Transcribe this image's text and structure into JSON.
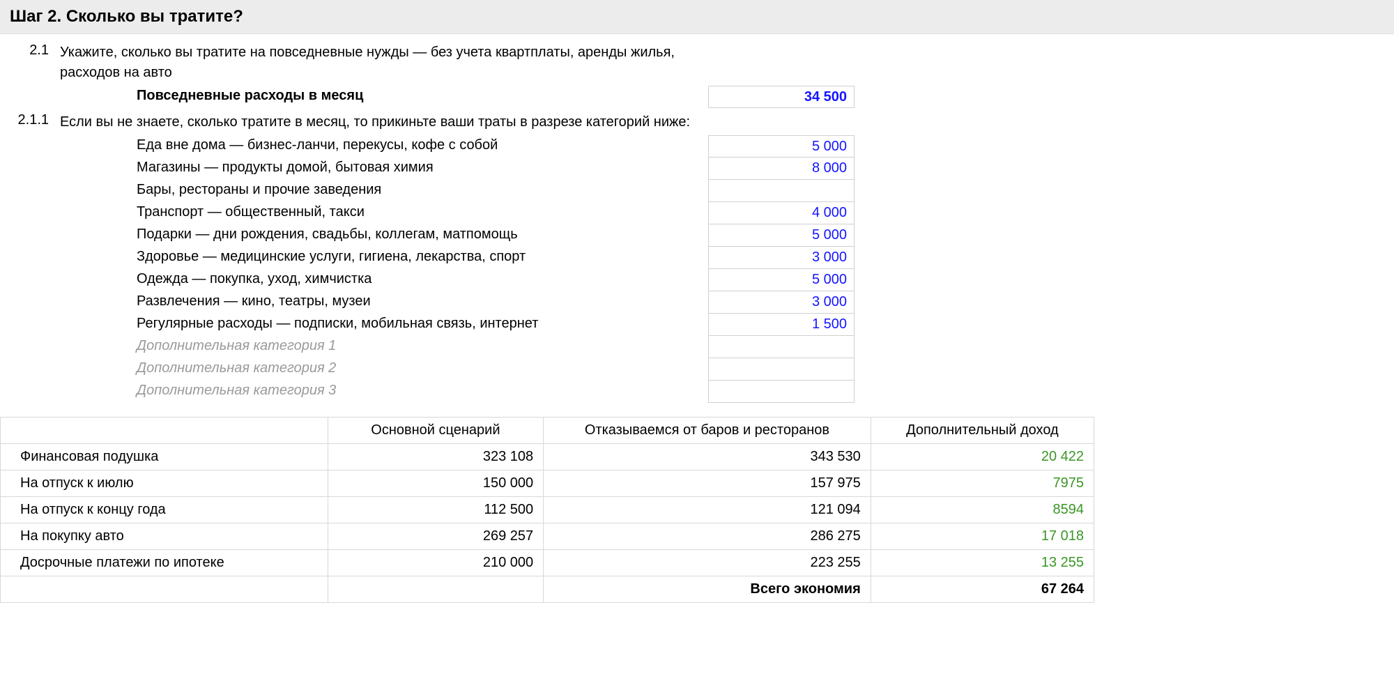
{
  "step": {
    "title": "Шаг 2. Сколько вы тратите?",
    "item21_num": "2.1",
    "item21_text": "Укажите, сколько вы тратите на повседневные нужды — без учета квартплаты, аренды жилья, расходов на авто",
    "monthly_label": "Повседневные расходы в месяц",
    "monthly_value": "34 500",
    "item211_num": "2.1.1",
    "item211_text": "Если вы не знаете, сколько тратите в месяц, то прикиньте ваши траты в разрезе категорий ниже:"
  },
  "categories": [
    {
      "label": "Еда вне дома — бизнес-ланчи, перекусы, кофе с собой",
      "value": "5 000",
      "placeholder": false
    },
    {
      "label": "Магазины — продукты домой, бытовая химия",
      "value": "8 000",
      "placeholder": false
    },
    {
      "label": "Бары, рестораны и прочие заведения",
      "value": "",
      "placeholder": false
    },
    {
      "label": "Транспорт — общественный, такси",
      "value": "4 000",
      "placeholder": false
    },
    {
      "label": "Подарки — дни рождения, свадьбы, коллегам, матпомощь",
      "value": "5 000",
      "placeholder": false
    },
    {
      "label": "Здоровье — медицинские услуги, гигиена, лекарства, спорт",
      "value": "3 000",
      "placeholder": false
    },
    {
      "label": "Одежда — покупка, уход, химчистка",
      "value": "5 000",
      "placeholder": false
    },
    {
      "label": "Развлечения — кино, театры, музеи",
      "value": "3 000",
      "placeholder": false
    },
    {
      "label": "Регулярные расходы — подписки, мобильная связь, интернет",
      "value": "1 500",
      "placeholder": false
    },
    {
      "label": "Дополнительная категория 1",
      "value": "",
      "placeholder": true
    },
    {
      "label": "Дополнительная категория 2",
      "value": "",
      "placeholder": true
    },
    {
      "label": "Дополнительная категория 3",
      "value": "",
      "placeholder": true
    }
  ],
  "summary": {
    "headers": [
      "",
      "Основной сценарий",
      "Отказываемся от баров и ресторанов",
      "Дополнительный доход"
    ],
    "rows": [
      {
        "label": "Финансовая подушка",
        "c1": "323 108",
        "c2": "343 530",
        "c3": "20 422"
      },
      {
        "label": "На отпуск к июлю",
        "c1": "150 000",
        "c2": "157 975",
        "c3": "7975"
      },
      {
        "label": "На отпуск к концу года",
        "c1": "112 500",
        "c2": "121 094",
        "c3": "8594"
      },
      {
        "label": "На покупку авто",
        "c1": "269 257",
        "c2": "286 275",
        "c3": "17 018"
      },
      {
        "label": "Досрочные платежи по ипотеке",
        "c1": "210 000",
        "c2": "223 255",
        "c3": "13 255"
      }
    ],
    "total_label": "Всего экономия",
    "total_value": "67 264"
  }
}
